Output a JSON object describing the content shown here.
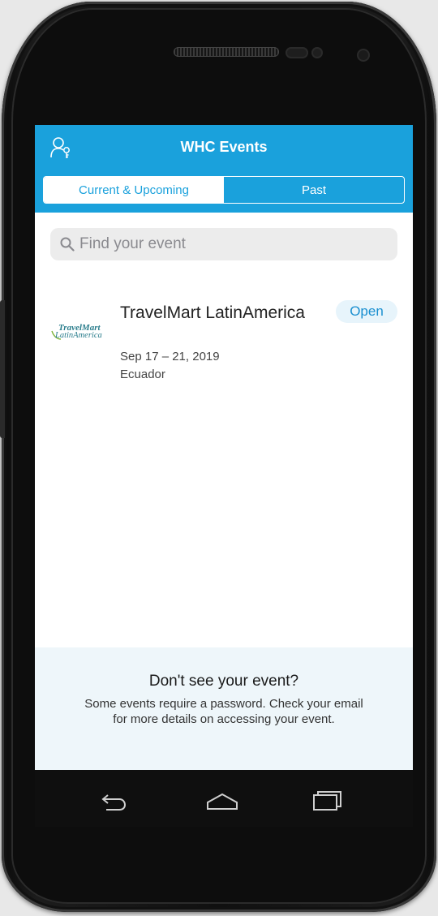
{
  "app": {
    "title": "WHC Events"
  },
  "tabs": [
    {
      "label": "Current & Upcoming",
      "active": true
    },
    {
      "label": "Past",
      "active": false
    }
  ],
  "search": {
    "placeholder": "Find your event",
    "value": ""
  },
  "events": [
    {
      "logo_line1": "TravelMart",
      "logo_line2": "LatinAmerica",
      "name": "TravelMart LatinAmerica",
      "dates": "Sep 17 – 21, 2019",
      "location": "Ecuador",
      "action_label": "Open"
    }
  ],
  "footer": {
    "title": "Don't see your event?",
    "text": "Some events require a password. Check your email for more details on accessing your event."
  },
  "icons": {
    "login": "login-key-icon",
    "search": "search-icon",
    "nav_back": "back-icon",
    "nav_home": "home-icon",
    "nav_recents": "recents-icon"
  },
  "colors": {
    "brand": "#1aa1dc",
    "open_button_bg": "#e7f4fb",
    "open_button_text": "#1a8fd0",
    "footer_bg": "#eef6fa"
  }
}
